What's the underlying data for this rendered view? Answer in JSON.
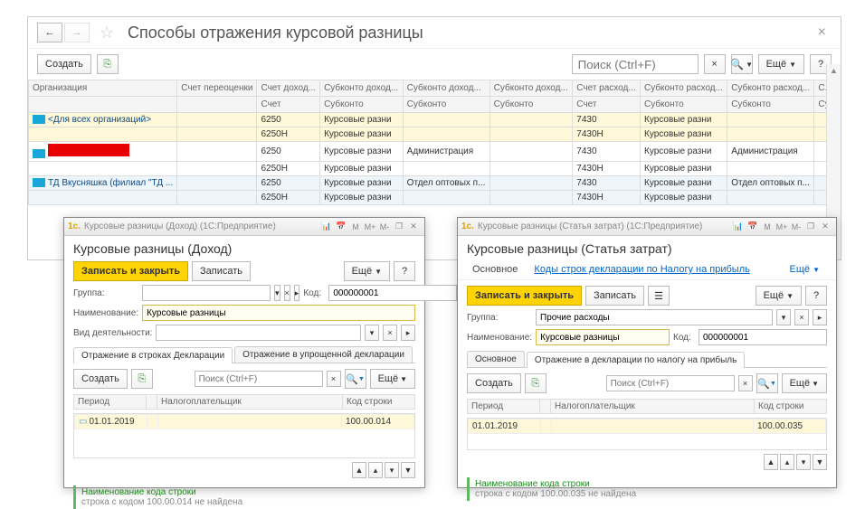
{
  "main": {
    "title": "Способы отражения курсовой разницы",
    "create_label": "Создать",
    "more_label": "Ещё",
    "search_placeholder": "Поиск (Ctrl+F)",
    "headers1": [
      "Организация",
      "Счет переоценки",
      "Счет доход...",
      "Субконто доход...",
      "Субконто доход...",
      "Субконто доход...",
      "Счет расход...",
      "Субконто расход...",
      "Субконто расход...",
      "С..."
    ],
    "headers2": [
      "",
      "",
      "Счет",
      "Субконто",
      "Субконто",
      "Субконто",
      "Счет",
      "Субконто",
      "Субконто",
      "Су..."
    ],
    "rows": [
      {
        "cls": "row-yellow",
        "org": "<Для всех организаций>",
        "red": false,
        "c": [
          "",
          "6250",
          "Курсовые разни",
          "",
          "",
          "7430",
          "Курсовые разни",
          "",
          ""
        ]
      },
      {
        "cls": "row-yellow",
        "org": "",
        "c": [
          "",
          "6250Н",
          "Курсовые разни",
          "",
          "",
          "7430Н",
          "Курсовые разни",
          "",
          ""
        ]
      },
      {
        "cls": "",
        "org": "",
        "red": true,
        "c": [
          "",
          "6250",
          "Курсовые разни",
          "Администрация",
          "",
          "7430",
          "Курсовые разни",
          "Администрация",
          ""
        ]
      },
      {
        "cls": "",
        "org": "",
        "c": [
          "",
          "6250Н",
          "Курсовые разни",
          "",
          "",
          "7430Н",
          "Курсовые разни",
          "",
          ""
        ]
      },
      {
        "cls": "row-blue",
        "org": "ТД Вкусняшка (филиал \"ТД ...",
        "red": false,
        "c": [
          "",
          "6250",
          "Курсовые разни",
          "Отдел оптовых п...",
          "",
          "7430",
          "Курсовые разни",
          "Отдел оптовых п...",
          ""
        ]
      },
      {
        "cls": "row-blue",
        "org": "",
        "c": [
          "",
          "6250Н",
          "Курсовые разни",
          "",
          "",
          "7430Н",
          "Курсовые разни",
          "",
          ""
        ]
      }
    ]
  },
  "dlg1": {
    "titlebar": "Курсовые разницы (Доход) (1С:Предприятие)",
    "header": "Курсовые разницы (Доход)",
    "save_close": "Записать и закрыть",
    "save": "Записать",
    "more": "Ещё",
    "group_label": "Группа:",
    "name_label": "Наименование:",
    "name_value": "Курсовые разницы",
    "code_label": "Код:",
    "code_value": "000000001",
    "activity_label": "Вид деятельности:",
    "tab1": "Отражение в строках Декларации",
    "tab2": "Отражение в упрощенной декларации",
    "create": "Создать",
    "search_ph": "Поиск (Ctrl+F)",
    "sub_headers": [
      "Период",
      "",
      "Налогоплательщик",
      "Код строки"
    ],
    "sub_row": {
      "period": "01.01.2019",
      "code": "100.00.014"
    },
    "info_title": "Наименование кода строки",
    "info_text": "строка с кодом 100.00.014 не найдена"
  },
  "dlg2": {
    "titlebar": "Курсовые разницы (Статья затрат) (1С:Предприятие)",
    "header": "Курсовые разницы (Статья затрат)",
    "nav_main": "Основное",
    "nav_link": "Коды строк декларации по Налогу на прибыль",
    "more": "Ещё",
    "save_close": "Записать и закрыть",
    "save": "Записать",
    "group_label": "Группа:",
    "group_value": "Прочие расходы",
    "name_label": "Наименование:",
    "name_value": "Курсовые разницы",
    "code_label": "Код:",
    "code_value": "000000001",
    "tab1": "Основное",
    "tab2": "Отражение в декларации по налогу на прибыль",
    "create": "Создать",
    "search_ph": "Поиск (Ctrl+F)",
    "sub_headers": [
      "Период",
      "",
      "Налогоплательщик",
      "Код строки"
    ],
    "sub_row": {
      "period": "01.01.2019",
      "code": "100.00.035"
    },
    "info_title": "Наименование кода строки",
    "info_text": "строка с кодом 100.00.035 не найдена"
  }
}
